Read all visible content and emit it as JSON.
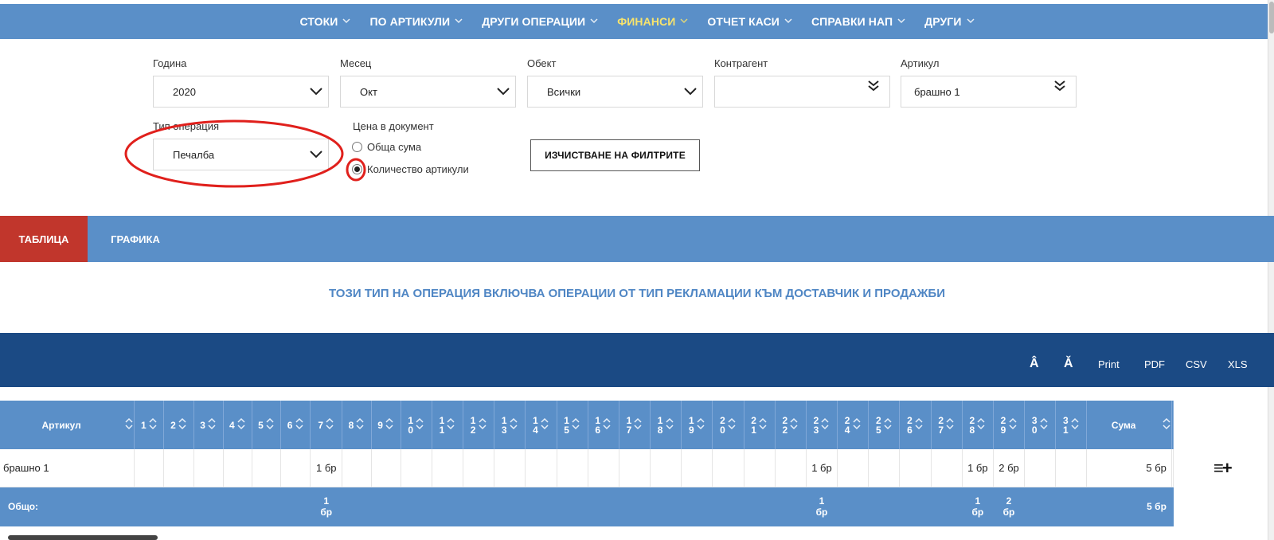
{
  "nav": {
    "items": [
      {
        "label": "СТОКИ",
        "active": false
      },
      {
        "label": "ПО АРТИКУЛИ",
        "active": false
      },
      {
        "label": "ДРУГИ ОПЕРАЦИИ",
        "active": false
      },
      {
        "label": "ФИНАНСИ",
        "active": true
      },
      {
        "label": "ОТЧЕТ КАСИ",
        "active": false
      },
      {
        "label": "СПРАВКИ НАП",
        "active": false
      },
      {
        "label": "ДРУГИ",
        "active": false
      }
    ],
    "active_color": "#f7e36d",
    "bar_color": "#5a8fc8"
  },
  "filters": {
    "year": {
      "label": "Година",
      "value": "2020"
    },
    "month": {
      "label": "Месец",
      "value": "Окт"
    },
    "object": {
      "label": "Обект",
      "value": "Всички"
    },
    "contragent": {
      "label": "Контрагент",
      "value": ""
    },
    "article": {
      "label": "Артикул",
      "value": "брашно 1"
    },
    "op_type": {
      "label": "Тип операция",
      "value": "Печалба"
    },
    "price": {
      "label": "Цена в документ",
      "options": [
        {
          "label": "Обща сума",
          "checked": false
        },
        {
          "label": "Количество артикули",
          "checked": true
        }
      ]
    },
    "clear_button": "ИЗЧИСТВАНЕ НА ФИЛТРИТЕ"
  },
  "tabs": {
    "table": "ТАБЛИЦА",
    "graph": "ГРАФИКА",
    "active_color": "#c1362c"
  },
  "info_message": "ТОЗИ ТИП НА ОПЕРАЦИЯ ВКЛЮЧВА ОПЕРАЦИИ ОТ ТИП РЕКЛАМАЦИИ КЪМ ДОСТАВЧИК И ПРОДАЖБИ",
  "toolbar": {
    "font_up_icon": "Â",
    "font_down_icon": "Ǎ",
    "print": "Print",
    "pdf": "PDF",
    "csv": "CSV",
    "xls": "XLS"
  },
  "table": {
    "article_header": "Артикул",
    "sum_header": "Сума",
    "days": [
      "1",
      "2",
      "3",
      "4",
      "5",
      "6",
      "7",
      "8",
      "9",
      "10",
      "11",
      "12",
      "13",
      "14",
      "15",
      "16",
      "17",
      "18",
      "19",
      "20",
      "21",
      "22",
      "23",
      "24",
      "25",
      "26",
      "27",
      "28",
      "29",
      "30",
      "31"
    ],
    "rows": [
      {
        "article": "брашно 1",
        "cells": [
          "",
          "",
          "",
          "",
          "",
          "",
          "1 бр",
          "",
          "",
          "",
          "",
          "",
          "",
          "",
          "",
          "",
          "",
          "",
          "",
          "",
          "",
          "",
          "1 бр",
          "",
          "",
          "",
          "",
          "1 бр",
          "2 бр",
          "",
          ""
        ],
        "sum": "5 бр"
      }
    ],
    "total": {
      "label": "Общо:",
      "cells": [
        "",
        "",
        "",
        "",
        "",
        "",
        "1 бр",
        "",
        "",
        "",
        "",
        "",
        "",
        "",
        "",
        "",
        "",
        "",
        "",
        "",
        "",
        "",
        "1 бр",
        "",
        "",
        "",
        "",
        "1 бр",
        "2 бр",
        "",
        ""
      ],
      "sum": "5 бр"
    }
  },
  "row_action_icon": "≡+",
  "annotation_color": "#e0201c"
}
